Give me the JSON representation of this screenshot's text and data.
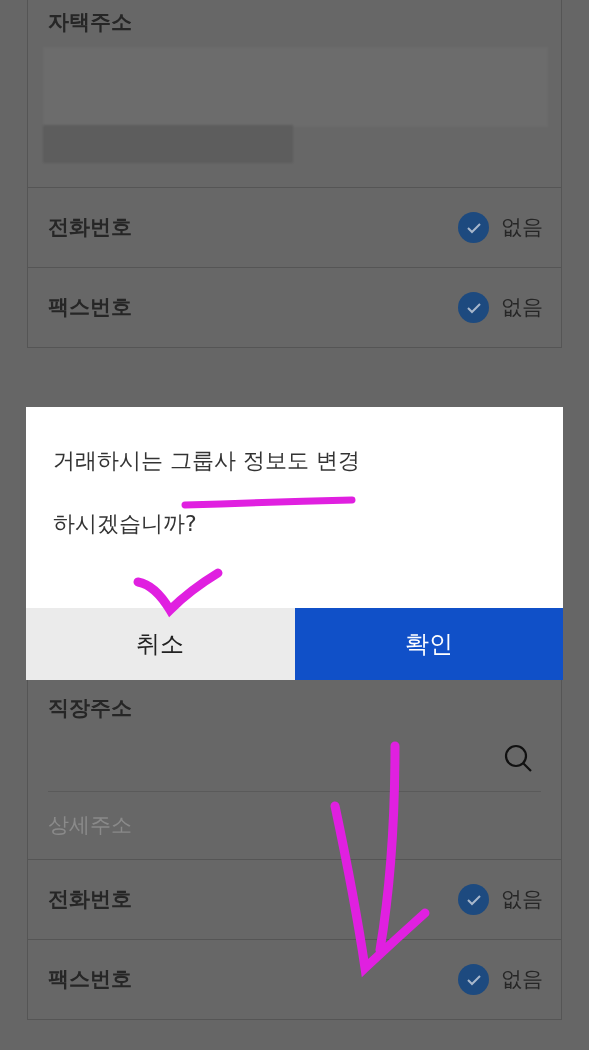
{
  "sections": [
    {
      "kind": "home",
      "address_label": "자택주소",
      "rows": [
        {
          "label": "전화번호",
          "checked": true,
          "option": "없음"
        },
        {
          "label": "팩스번호",
          "checked": true,
          "option": "없음"
        }
      ]
    },
    {
      "kind": "work",
      "address_label": "직장주소",
      "detail_placeholder": "상세주소",
      "rows": [
        {
          "label": "전화번호",
          "checked": true,
          "option": "없음"
        },
        {
          "label": "팩스번호",
          "checked": true,
          "option": "없음"
        }
      ]
    }
  ],
  "dialog": {
    "message_lines": [
      "거래하시는 그룹사 정보도 변경",
      "하시겠습니까?"
    ],
    "buttons": [
      {
        "label": "취소",
        "kind": "cancel"
      },
      {
        "label": "확인",
        "kind": "confirm"
      }
    ]
  }
}
